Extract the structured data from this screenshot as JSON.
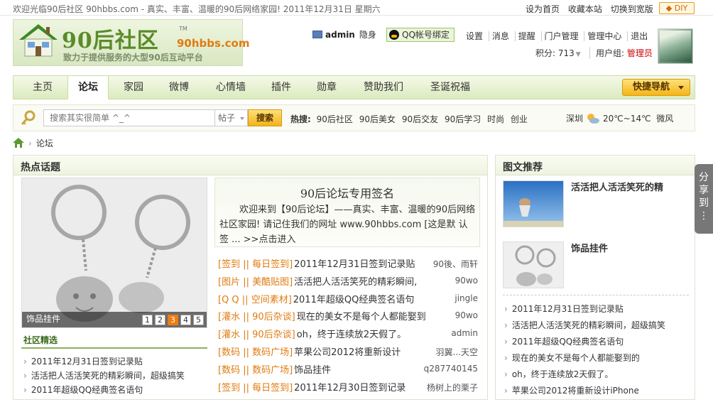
{
  "topbar": {
    "welcome": "欢迎光临90后社区 90hbbs.com - 真实、丰富、温暖的90后网络家园!  2011年12月31日 星期六",
    "links": [
      "设为首页",
      "收藏本站",
      "切换到宽版"
    ],
    "diy_label": "◆ DIY"
  },
  "logo": {
    "text": "90后社区",
    "tm": "TM",
    "domain": "90hbbs.com",
    "slogan": "致力于提供服务的大型90后互动平台"
  },
  "user": {
    "name": "admin",
    "hidden_label": "隐身",
    "qq_bind_label": "QQ帐号绑定",
    "links": [
      "设置",
      "消息",
      "提醒",
      "门户管理",
      "管理中心",
      "退出"
    ],
    "points_label": "积分: 713",
    "group_label": "用户组: ",
    "group_value": "管理员"
  },
  "nav": {
    "items": [
      "主页",
      "论坛",
      "家园",
      "微博",
      "心情墙",
      "插件",
      "勋章",
      "赞助我们",
      "圣诞祝福"
    ],
    "active": "论坛",
    "quick_nav_label": "快捷导航"
  },
  "search": {
    "placeholder": "搜索其实很简单 ^_^",
    "type_selected": "帖子",
    "button_label": "搜索",
    "hot_label": "热搜:",
    "hotwords": [
      "90后社区",
      "90后美女",
      "90后交友",
      "90后学习",
      "时尚",
      "创业"
    ],
    "weather_city": "深圳",
    "weather_temp": "20℃~14℃",
    "weather_wind": "微风"
  },
  "breadcrumb": {
    "sep": "›",
    "current": "论坛"
  },
  "hot": {
    "title": "热点话题",
    "slide_caption": "饰品挂件",
    "slide_pages": [
      "1",
      "2",
      "3",
      "4",
      "5"
    ],
    "slide_active": 3,
    "picks_title": "社区精选",
    "picks": [
      "2011年12月31日签到记录贴",
      "活活把人活活笑死的精彩瞬间，超级搞笑",
      "2011年超级QQ经典签名语句"
    ],
    "sig_title": "90后论坛专用签名",
    "sig_body": "欢迎来到【90后论坛】——真实、丰富、温暖的90后网络社区家园! 请记住我们的网址 www.90hbbs.com [这是默 认签 ... >>点击进入",
    "threads": [
      {
        "tag": "[签到 || 每日签到]",
        "title": "2011年12月31日签到记录贴",
        "author": "90後、雨轩"
      },
      {
        "tag": "[图片 || 美酷贴图]",
        "title": "活活把人活活笑死的精彩瞬间,",
        "author": "90wo"
      },
      {
        "tag": "[Q Q || 空间素材]",
        "title": "2011年超级QQ经典签名语句",
        "author": "jingle"
      },
      {
        "tag": "[灌水 || 90后杂谈]",
        "title": "现在的美女不是每个人都能娶到",
        "author": "90wo"
      },
      {
        "tag": "[灌水 || 90后杂谈]",
        "title": "oh，终于连续放2天假了。",
        "author": "admin"
      },
      {
        "tag": "[数码 || 数码广场]",
        "title": "苹果公司2012将重新设计",
        "author": "羽翼...天空"
      },
      {
        "tag": "[数码 || 数码广场]",
        "title": "饰品挂件",
        "author": "q287740145"
      },
      {
        "tag": "[签到 || 每日签到]",
        "title": "2011年12月30日签到记录",
        "author": "杨树上的栗子"
      }
    ]
  },
  "recommend": {
    "title": "图文推荐",
    "cards": [
      {
        "title": "活活把人活活笑死的精"
      },
      {
        "title": "饰品挂件"
      }
    ],
    "items": [
      "2011年12月31日签到记录贴",
      "活活把人活活笑死的精彩瞬间，超级搞笑",
      "2011年超级QQ经典签名语句",
      "现在的美女不是每个人都能娶到的",
      "oh，终于连续放2天假了。",
      "苹果公司2012将重新设计iPhone"
    ]
  },
  "share": {
    "label": "分享到"
  },
  "colors": {
    "nav_green": "#dcebbf",
    "accent_orange": "#e07b10",
    "group_red": "#cc0000"
  }
}
